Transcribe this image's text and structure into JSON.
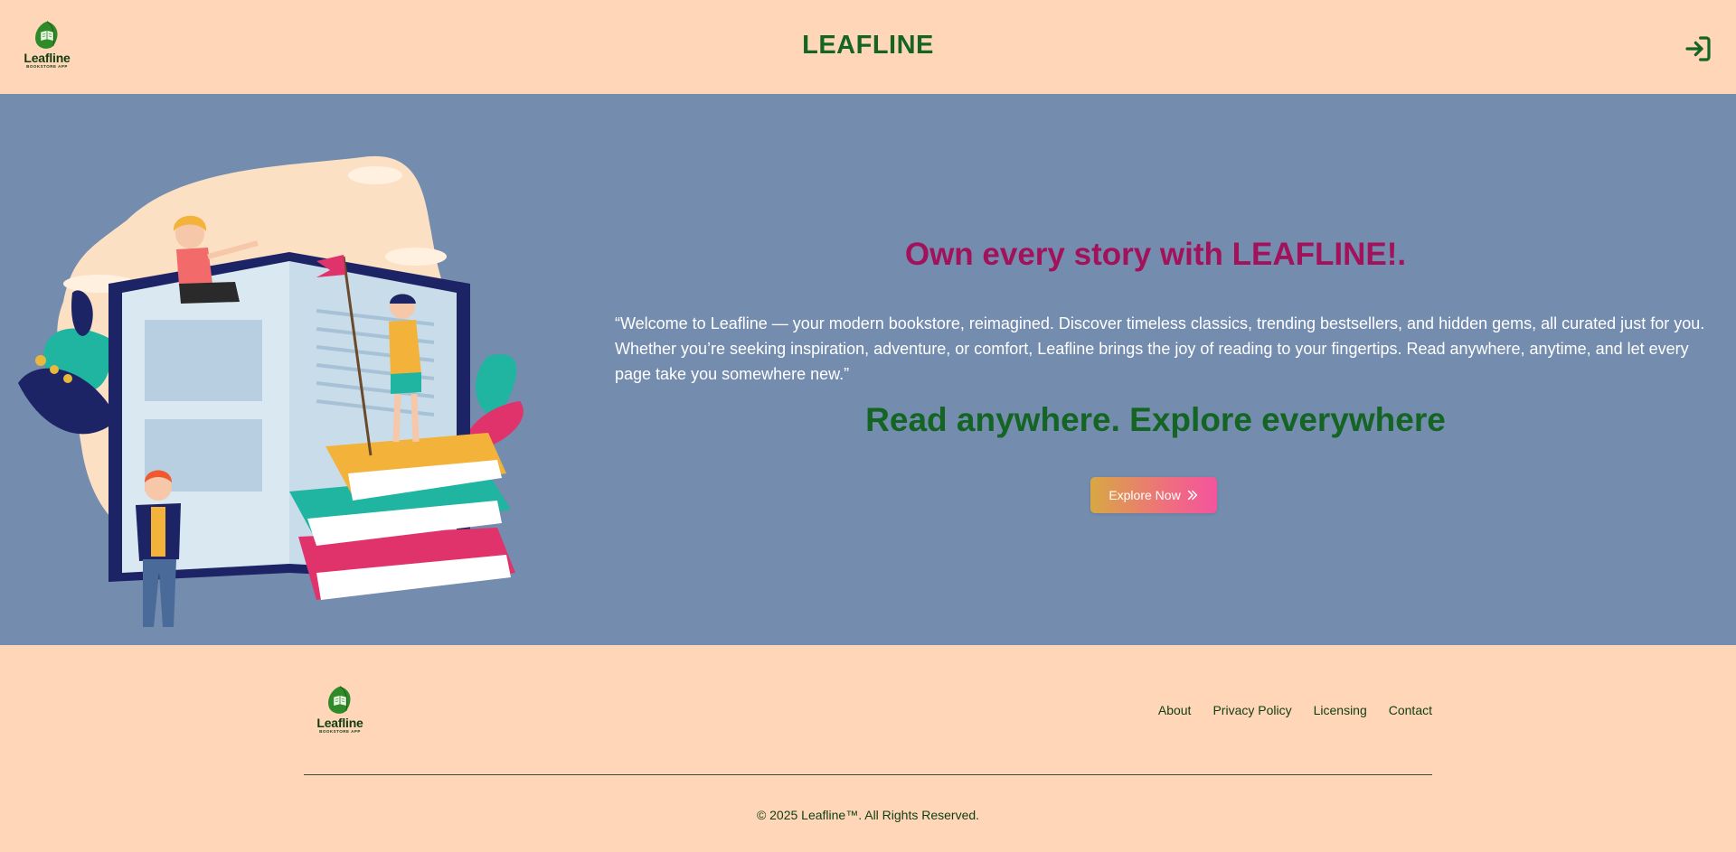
{
  "header": {
    "logo": {
      "name": "Leafline",
      "subtitle": "BOOKSTORE APP",
      "icon": "leaf-book-icon"
    },
    "brand": "LEAFLINE",
    "login_icon": "login-icon"
  },
  "hero": {
    "title": "Own every story with LEAFLINE!.",
    "description": "“Welcome to Leafline — your modern bookstore, reimagined. Discover timeless classics, trending bestsellers, and hidden gems, all curated just for you. Whether you’re seeking inspiration, adventure, or comfort, Leafline brings the joy of reading to your fingertips. Read anywhere, anytime, and let every page take you somewhere new.”",
    "tagline": "Read anywhere. Explore everywhere",
    "cta_label": "Explore Now",
    "cta_icon": "double-chevron-right-icon",
    "illustration": "kids-with-books-illustration"
  },
  "footer": {
    "logo": {
      "name": "Leafline",
      "subtitle": "BOOKSTORE APP"
    },
    "links": [
      "About",
      "Privacy Policy",
      "Licensing",
      "Contact"
    ],
    "copyright": "© 2025 Leafline™. All Rights Reserved."
  },
  "colors": {
    "header_bg": "#ffd6b8",
    "hero_bg": "#748cae",
    "brand_green": "#146424",
    "hero_title": "#a2125a",
    "cta_gradient_start": "#d8a843",
    "cta_gradient_end": "#f4549c"
  }
}
